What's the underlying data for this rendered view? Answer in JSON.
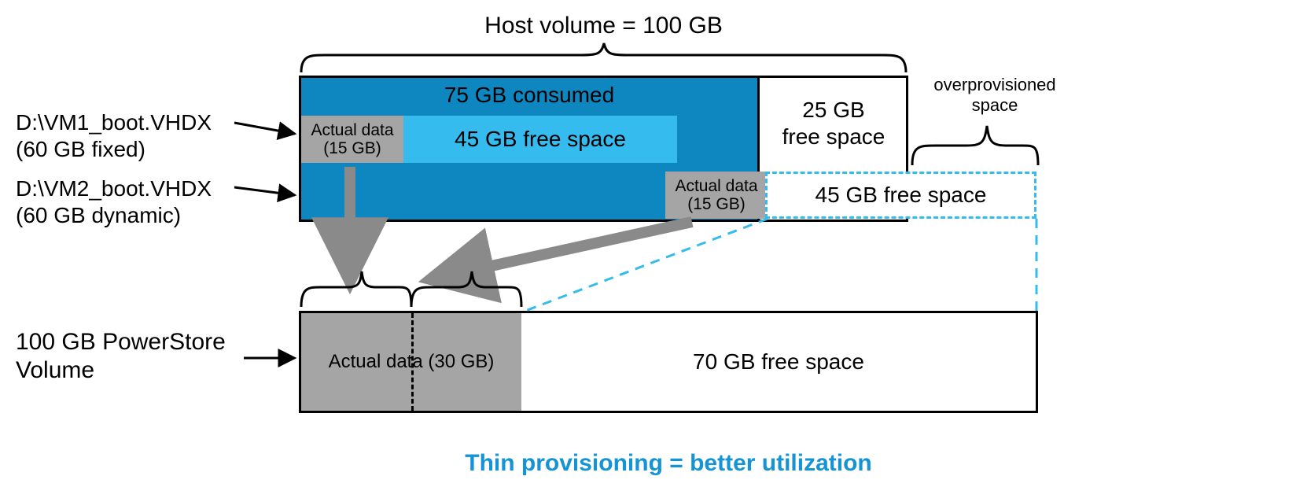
{
  "title_top": "Host volume = 100 GB",
  "overprovisioned": "overprovisioned",
  "overprovisioned2": "space",
  "vm1_line1": "D:\\VM1_boot.VHDX",
  "vm1_line2": "(60 GB fixed)",
  "vm2_line1": "D:\\VM2_boot.VHDX",
  "vm2_line2": "(60 GB dynamic)",
  "consumed": "75 GB consumed",
  "row1_actual": "Actual data\n(15 GB)",
  "row1_free": "45 GB free space",
  "row2_actual": "Actual data\n(15 GB)",
  "row2_free": "45 GB free space",
  "host_free": "25 GB\nfree space",
  "ps_label_line1": "100 GB PowerStore",
  "ps_label_line2": "Volume",
  "ps_actual": "Actual data (30 GB)",
  "ps_free": "70 GB free space",
  "caption": "Thin provisioning = better utilization",
  "chart_data": {
    "type": "bar",
    "title": "Thin provisioning = better utilization",
    "host_volume_gb": 100,
    "host_consumed_gb": 75,
    "host_free_gb": 25,
    "vm1": {
      "name": "D:\\VM1_boot.VHDX",
      "type": "fixed",
      "size_gb": 60,
      "actual_data_gb": 15,
      "free_space_gb": 45
    },
    "vm2": {
      "name": "D:\\VM2_boot.VHDX",
      "type": "dynamic",
      "size_gb": 60,
      "actual_data_gb": 15,
      "free_space_gb": 45,
      "overprovisioned": true
    },
    "powerstore_volume": {
      "size_gb": 100,
      "actual_data_gb": 30,
      "free_space_gb": 70
    }
  }
}
